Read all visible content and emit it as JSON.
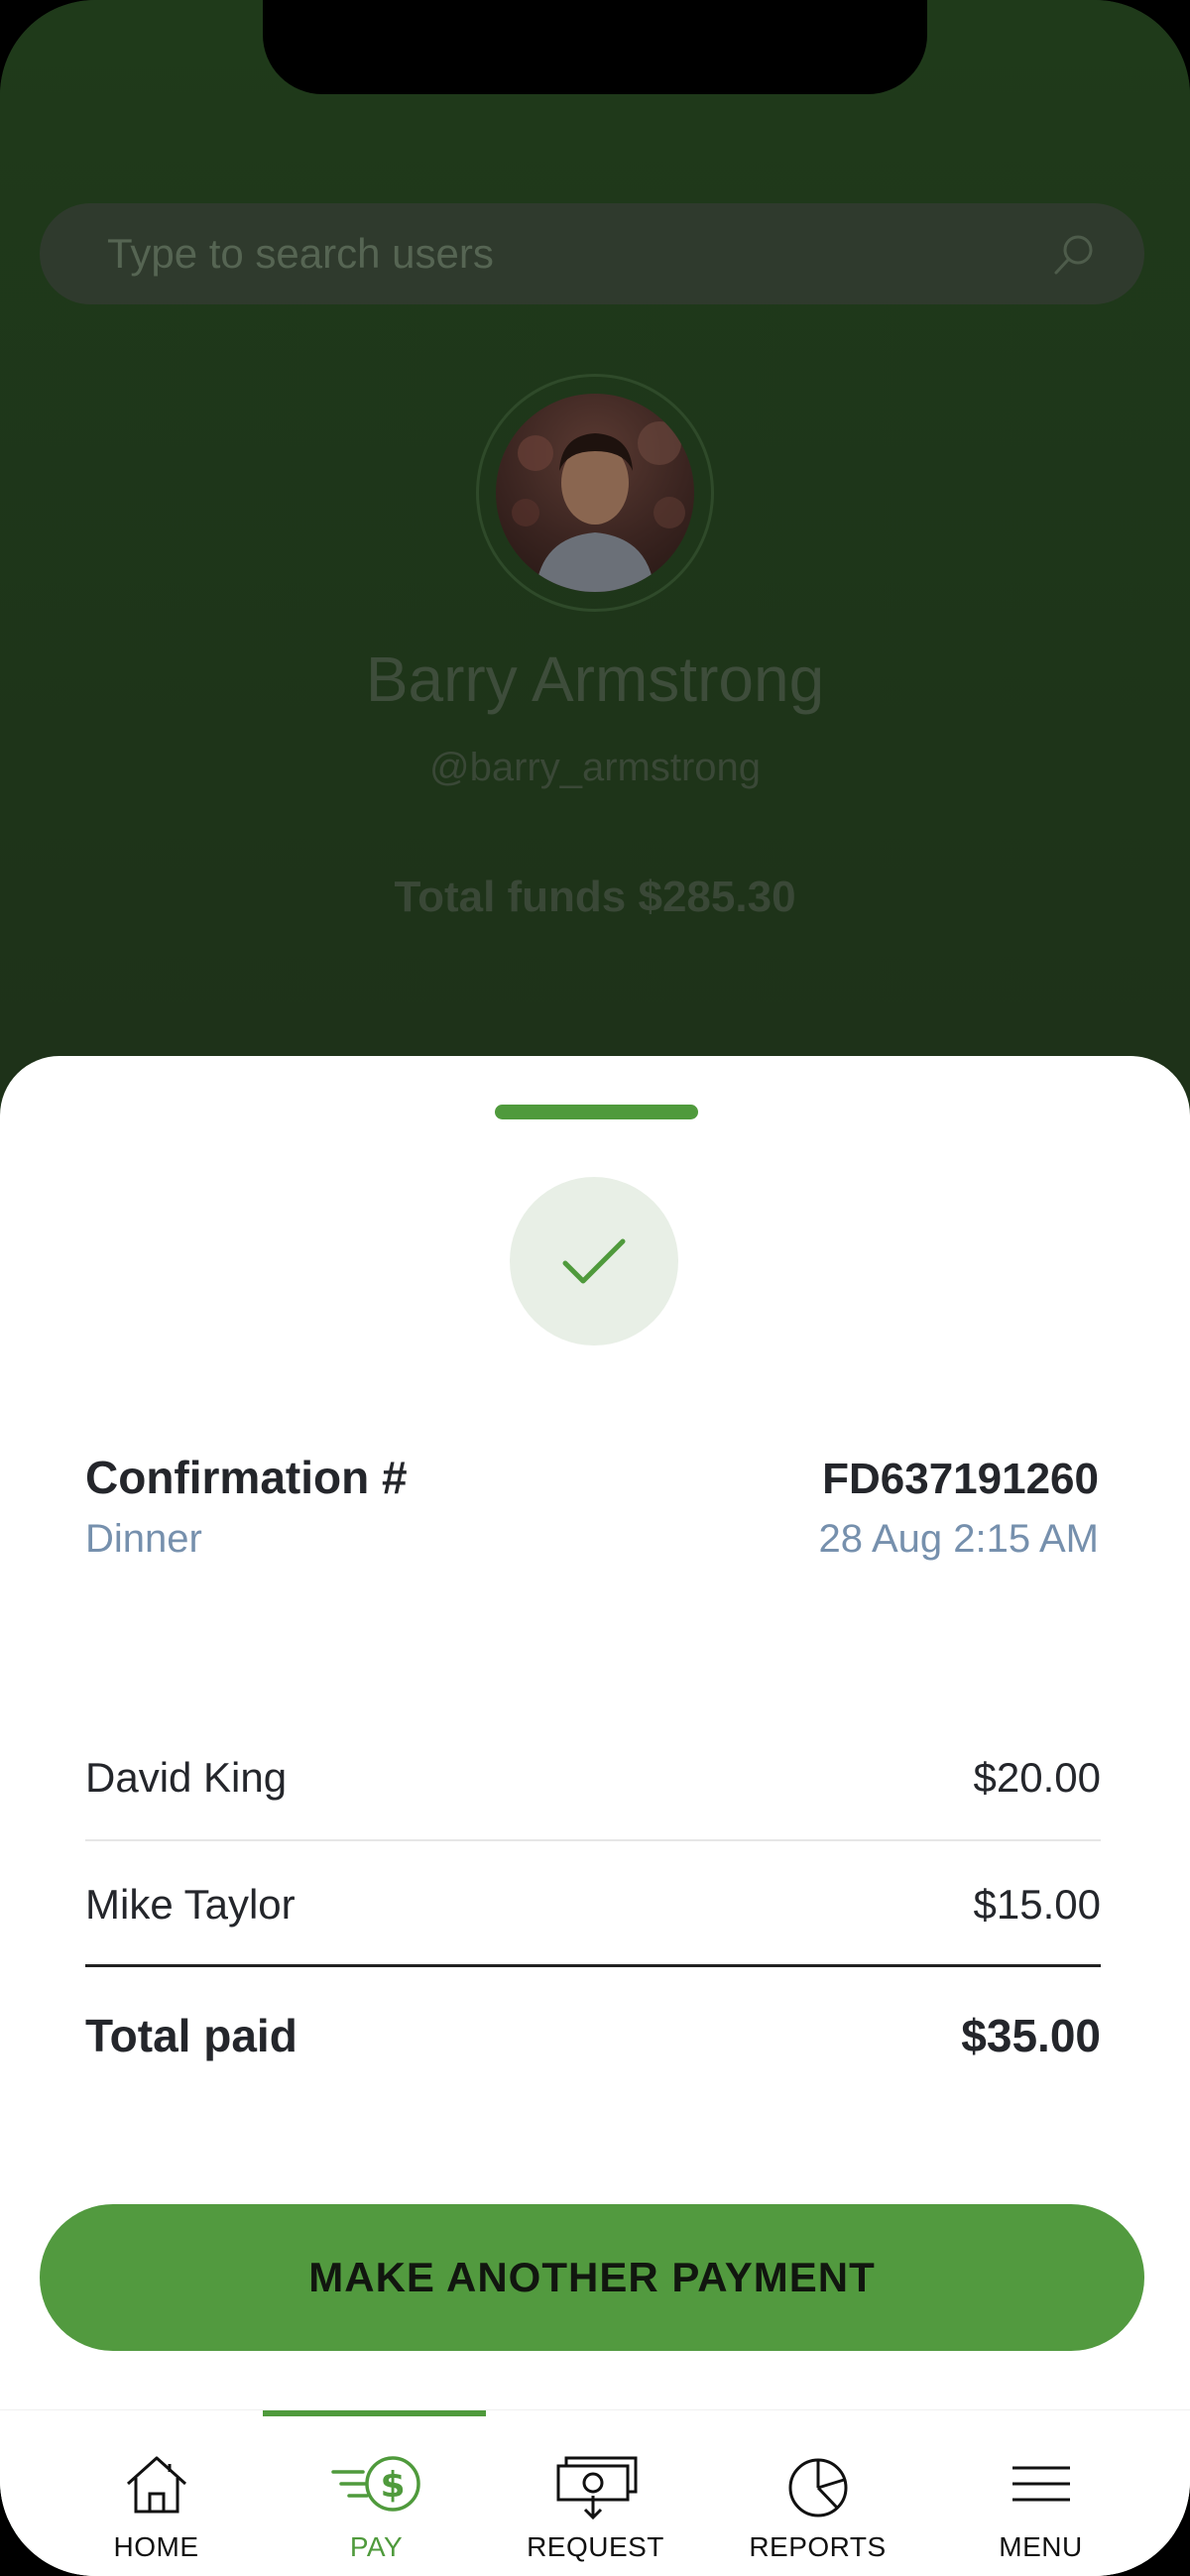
{
  "search": {
    "placeholder": "Type to search users",
    "icon": "search-icon"
  },
  "profile": {
    "name": "Barry Armstrong",
    "handle": "@barry_armstrong",
    "funds": "Total funds $285.30"
  },
  "confirmation": {
    "label": "Confirmation #",
    "number": "FD637191260",
    "description": "Dinner",
    "date": "28 Aug 2:15 AM",
    "status_icon": "check-icon"
  },
  "payments": [
    {
      "name": "David King",
      "amount": "$20.00"
    },
    {
      "name": "Mike Taylor",
      "amount": "$15.00"
    }
  ],
  "total": {
    "label": "Total paid",
    "amount": "$35.00"
  },
  "cta": {
    "label": "MAKE ANOTHER PAYMENT"
  },
  "tabs": [
    {
      "label": "HOME",
      "icon": "home-icon",
      "active": false
    },
    {
      "label": "PAY",
      "icon": "pay-icon",
      "active": true
    },
    {
      "label": "REQUEST",
      "icon": "request-icon",
      "active": false
    },
    {
      "label": "REPORTS",
      "icon": "reports-icon",
      "active": false
    },
    {
      "label": "MENU",
      "icon": "menu-icon",
      "active": false
    }
  ],
  "colors": {
    "accent": "#4f9a3c",
    "button": "#529a3f",
    "muted_text": "#7690ad",
    "overlay_bg": "#1e3319"
  }
}
